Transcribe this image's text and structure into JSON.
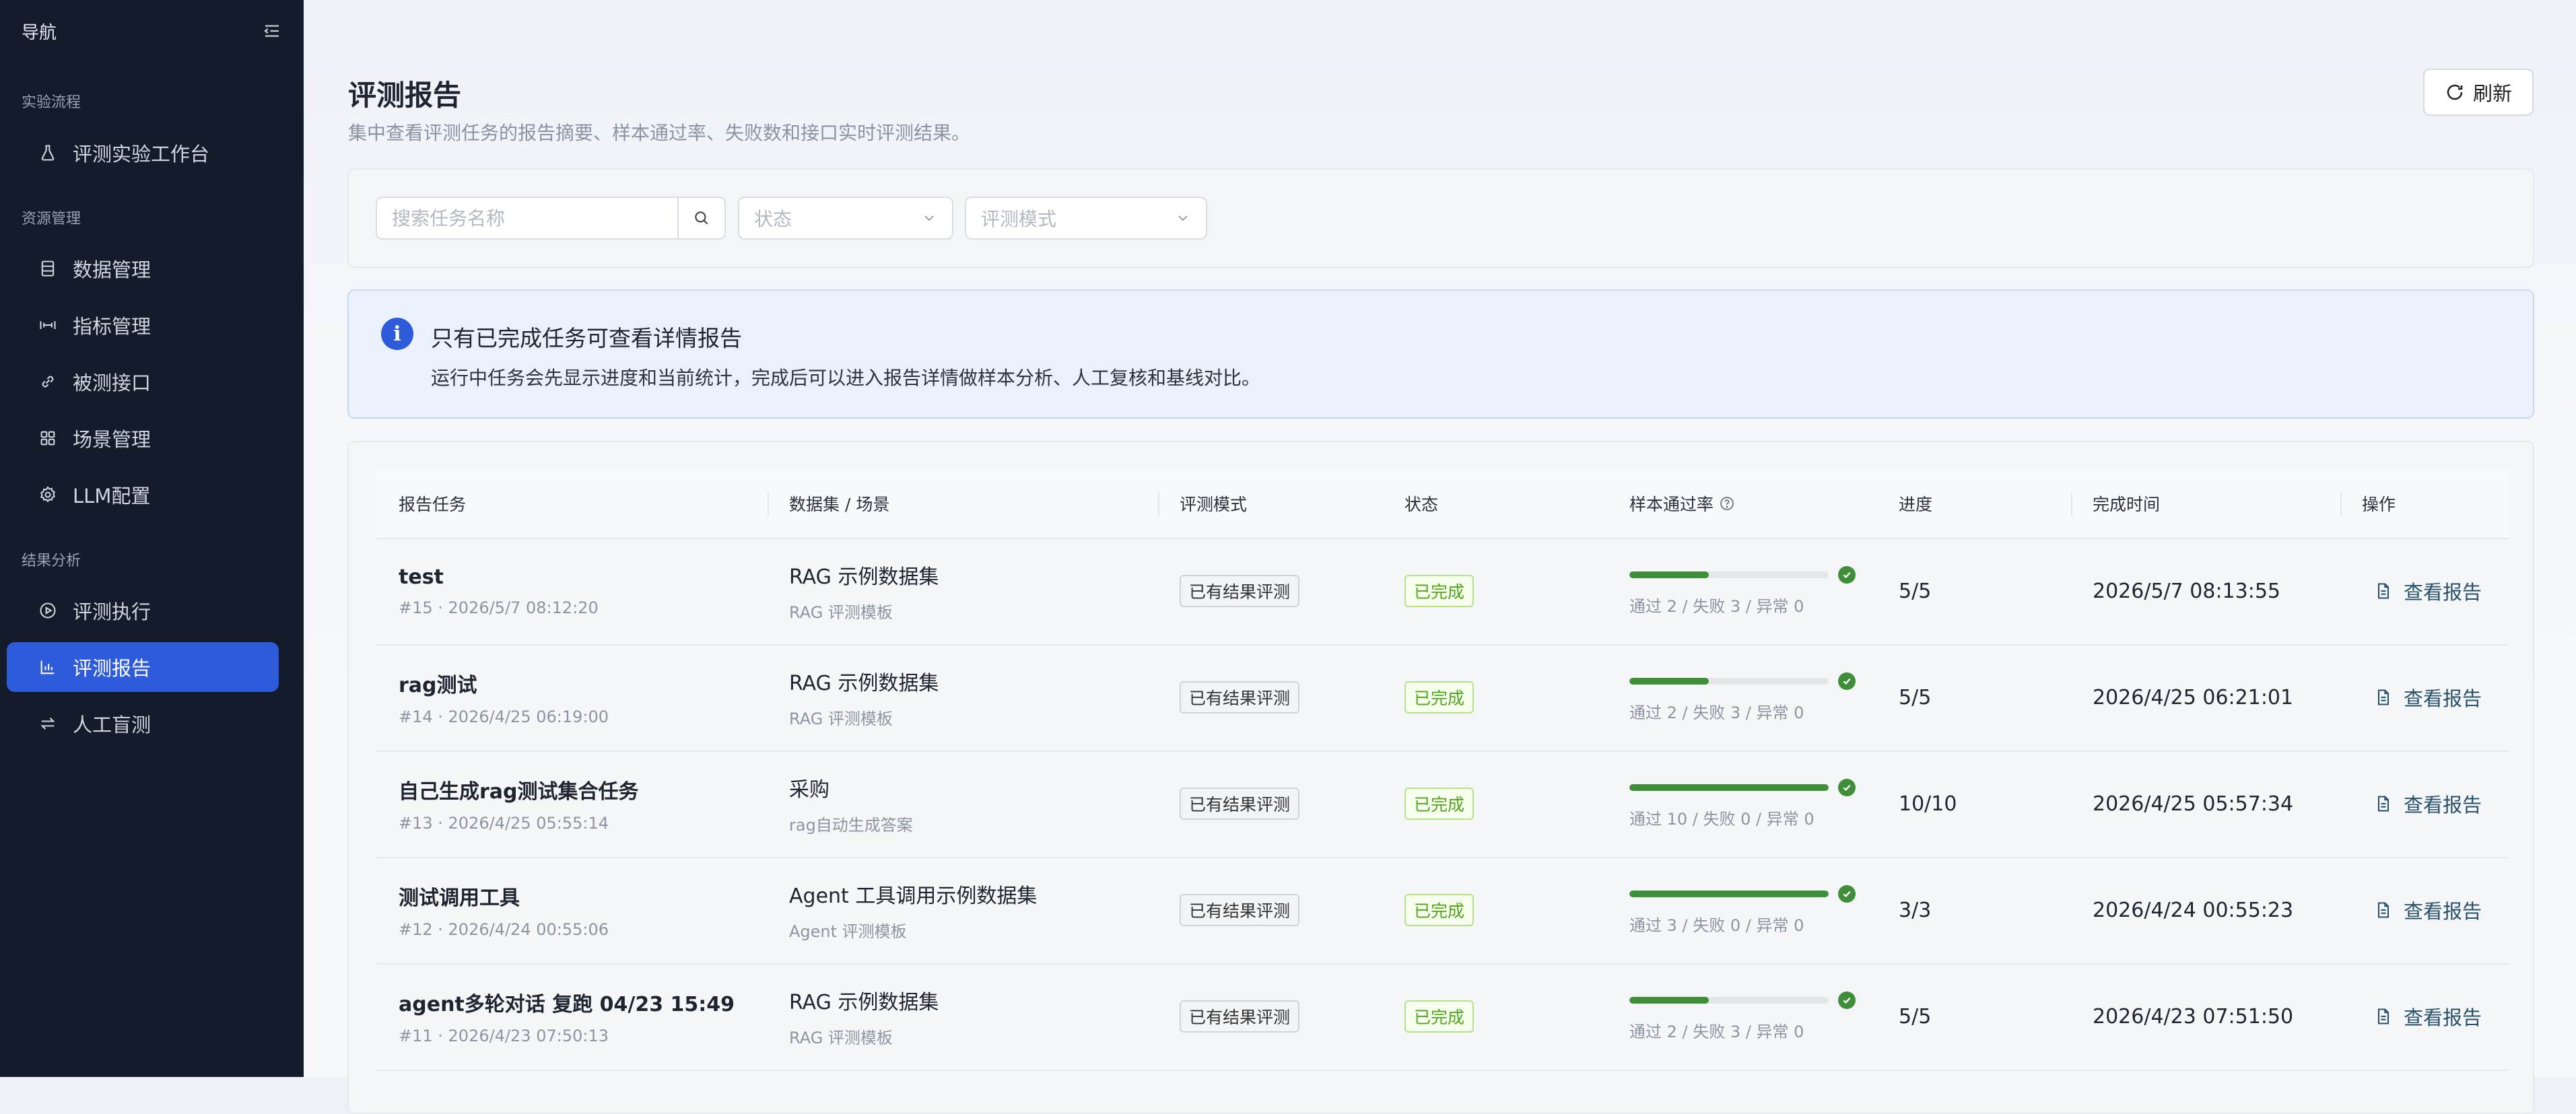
{
  "sidebar": {
    "title": "导航",
    "groups": [
      {
        "label": "实验流程"
      },
      {
        "label": "资源管理"
      },
      {
        "label": "结果分析"
      }
    ],
    "items": [
      {
        "label": "评测实验工作台",
        "icon": "flask-icon"
      },
      {
        "label": "数据管理",
        "icon": "database-icon"
      },
      {
        "label": "指标管理",
        "icon": "metric-icon"
      },
      {
        "label": "被测接口",
        "icon": "link-icon"
      },
      {
        "label": "场景管理",
        "icon": "grid-icon"
      },
      {
        "label": "LLM配置",
        "icon": "gear-icon"
      },
      {
        "label": "评测执行",
        "icon": "play-icon"
      },
      {
        "label": "评测报告",
        "icon": "chart-icon",
        "active": true
      },
      {
        "label": "人工盲测",
        "icon": "swap-icon"
      }
    ]
  },
  "header": {
    "title": "评测报告",
    "subtitle": "集中查看评测任务的报告摘要、样本通过率、失败数和接口实时评测结果。",
    "refresh_label": "刷新"
  },
  "filters": {
    "search_placeholder": "搜索任务名称",
    "status_placeholder": "状态",
    "mode_placeholder": "评测模式"
  },
  "notice": {
    "title": "只有已完成任务可查看详情报告",
    "text": "运行中任务会先显示进度和当前统计，完成后可以进入报告详情做样本分析、人工复核和基线对比。"
  },
  "table": {
    "columns": [
      "报告任务",
      "数据集 / 场景",
      "评测模式",
      "状态",
      "样本通过率",
      "进度",
      "完成时间",
      "操作"
    ],
    "rows": [
      {
        "name": "test",
        "meta": "#15 · 2026/5/7 08:12:20",
        "dataset": "RAG 示例数据集",
        "scene": "RAG 评测模板",
        "mode": "已有结果评测",
        "status": "已完成",
        "pass_rate": 0.4,
        "rate_text": "通过 2 / 失败 3 / 异常 0",
        "progress": "5/5",
        "finished": "2026/5/7 08:13:55",
        "action": "查看报告"
      },
      {
        "name": "rag测试",
        "meta": "#14 · 2026/4/25 06:19:00",
        "dataset": "RAG 示例数据集",
        "scene": "RAG 评测模板",
        "mode": "已有结果评测",
        "status": "已完成",
        "pass_rate": 0.4,
        "rate_text": "通过 2 / 失败 3 / 异常 0",
        "progress": "5/5",
        "finished": "2026/4/25 06:21:01",
        "action": "查看报告"
      },
      {
        "name": "自己生成rag测试集合任务",
        "meta": "#13 · 2026/4/25 05:55:14",
        "dataset": "采购",
        "scene": "rag自动生成答案",
        "mode": "已有结果评测",
        "status": "已完成",
        "pass_rate": 1.0,
        "rate_text": "通过 10 / 失败 0 / 异常 0",
        "progress": "10/10",
        "finished": "2026/4/25 05:57:34",
        "action": "查看报告"
      },
      {
        "name": "测试调用工具",
        "meta": "#12 · 2026/4/24 00:55:06",
        "dataset": "Agent 工具调用示例数据集",
        "scene": "Agent 评测模板",
        "mode": "已有结果评测",
        "status": "已完成",
        "pass_rate": 1.0,
        "rate_text": "通过 3 / 失败 0 / 异常 0",
        "progress": "3/3",
        "finished": "2026/4/24 00:55:23",
        "action": "查看报告"
      },
      {
        "name": "agent多轮对话 复跑 04/23 15:49",
        "meta": "#11 · 2026/4/23 07:50:13",
        "dataset": "RAG 示例数据集",
        "scene": "RAG 评测模板",
        "mode": "已有结果评测",
        "status": "已完成",
        "pass_rate": 0.4,
        "rate_text": "通过 2 / 失败 3 / 异常 0",
        "progress": "5/5",
        "finished": "2026/4/23 07:51:50",
        "action": "查看报告"
      }
    ]
  },
  "colors": {
    "sidebar_bg": "#141c2c",
    "accent": "#2e5bd9",
    "success": "#3f8f3a",
    "done_tag": "#52a41a"
  }
}
